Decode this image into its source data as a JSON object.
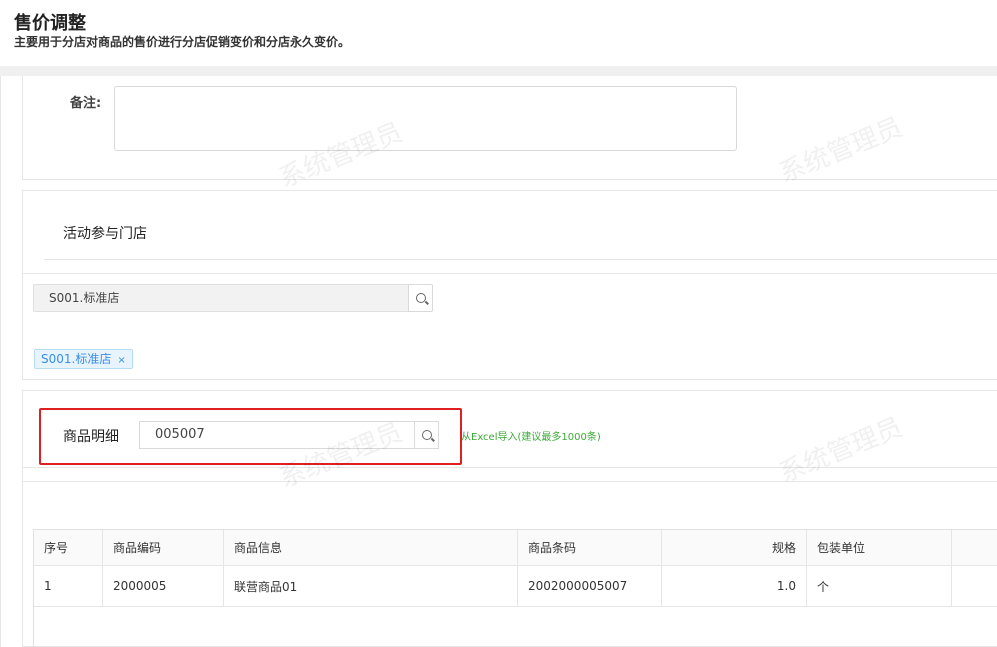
{
  "header": {
    "title": "售价调整",
    "subtitle": "主要用于分店对商品的售价进行分店促销变价和分店永久变价。"
  },
  "remark": {
    "label": "备注:",
    "value": ""
  },
  "stores": {
    "title": "活动参与门店",
    "input_value": "S001.标准店",
    "selected_tags": [
      "S001.标准店"
    ],
    "tag_close": "×"
  },
  "goods": {
    "label": "商品明细",
    "input_value": "005007",
    "import_hint": "从Excel导入(建议最多1000条)"
  },
  "table": {
    "headers": [
      "序号",
      "商品编码",
      "商品信息",
      "商品条码",
      "规格",
      "包装单位",
      ""
    ],
    "rows": [
      [
        "1",
        "2000005",
        "联营商品01",
        "2002000005007",
        "1.0",
        "个",
        ""
      ]
    ]
  },
  "watermark": "系统管理员",
  "icons": {
    "store_search": "search-icon",
    "goods_search": "search-icon"
  },
  "colors": {
    "highlight": "#e02020",
    "tag_blue": "#3a8ee6",
    "hint_green": "#3aaa35"
  }
}
